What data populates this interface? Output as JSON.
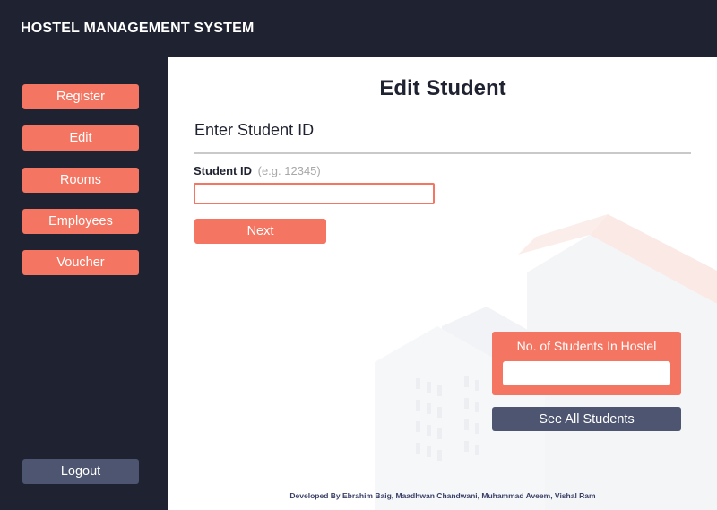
{
  "app": {
    "title": "HOSTEL MANAGEMENT SYSTEM"
  },
  "sidebar": {
    "items": [
      {
        "label": "Register"
      },
      {
        "label": "Edit"
      },
      {
        "label": "Rooms"
      },
      {
        "label": "Employees"
      },
      {
        "label": "Voucher"
      }
    ],
    "logout_label": "Logout"
  },
  "main": {
    "title": "Edit Student",
    "section_title": "Enter Student ID",
    "student_id": {
      "label": "Student ID",
      "hint": "(e.g. 12345)",
      "value": ""
    },
    "next_label": "Next",
    "students_count": {
      "title": "No. of Students In Hostel",
      "value": ""
    },
    "see_all_label": "See All Students",
    "footer": "Developed By Ebrahim Baig, Maadhwan Chandwani, Muhammad Aveem, Vishal Ram"
  },
  "colors": {
    "dark": "#1f2230",
    "accent": "#f47561",
    "slate": "#4d5570"
  }
}
